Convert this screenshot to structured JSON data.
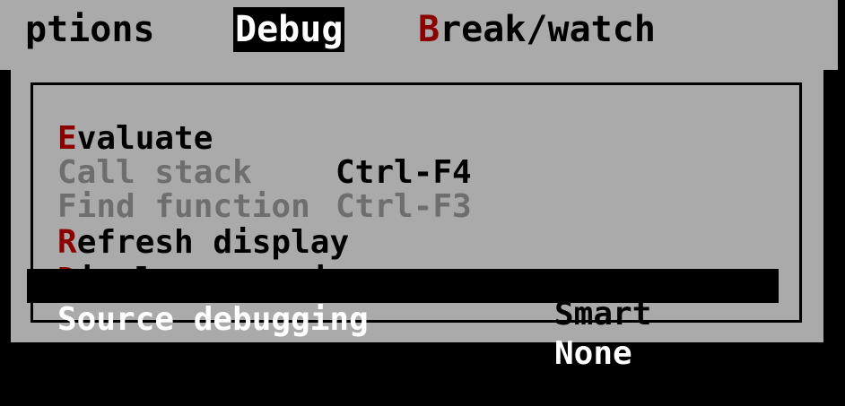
{
  "menubar": {
    "options": {
      "label": "ptions"
    },
    "debug": {
      "label": "Debug"
    },
    "break_watch": {
      "hotkey": "B",
      "rest": "reak/watch"
    }
  },
  "debug_menu": {
    "items": [
      {
        "hotkey": "E",
        "rest": "valuate",
        "shortcut": "Ctrl-F4",
        "state": "enabled"
      },
      {
        "text": "Call stack",
        "shortcut": "Ctrl-F3",
        "state": "disabled"
      },
      {
        "text": "Find function",
        "state": "disabled"
      },
      {
        "hotkey": "R",
        "rest": "efresh display",
        "state": "enabled"
      },
      {
        "hotkey": "D",
        "rest": "isplay swapping",
        "value": "Smart",
        "state": "enabled"
      },
      {
        "text": "Source debugging",
        "value": "None",
        "state": "selected"
      }
    ]
  },
  "colors": {
    "menu_bg": "#aaaaaa",
    "hotkey": "#8b0000",
    "disabled_text": "#6e6e6e",
    "selection_bg": "#000000",
    "selection_text": "#ffffff"
  }
}
